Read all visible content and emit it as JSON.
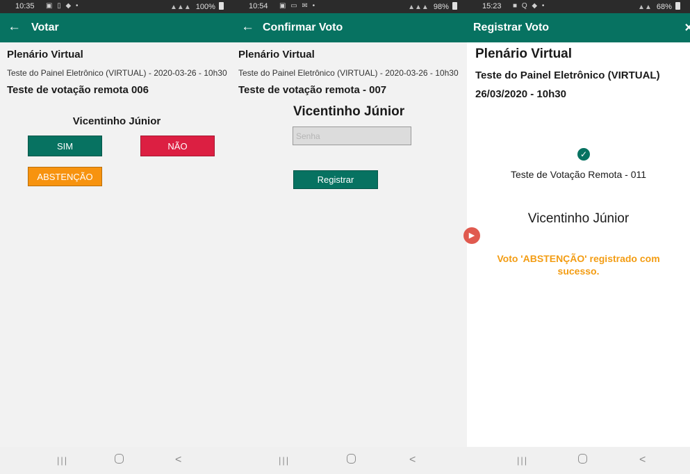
{
  "screen1": {
    "status": {
      "time": "10:35",
      "icons": "▣ ▯ ◆ •",
      "signal": "▲▲▲",
      "battery": "100%"
    },
    "appbar": {
      "back": "←",
      "title": "Votar"
    },
    "org_title": "Plenário Virtual",
    "session": "Teste do Painel Eletrônico (VIRTUAL) - 2020-03-26 - 10h30",
    "vote_title": "Teste de votação remota 006",
    "voter_name": "Vicentinho Júnior",
    "buttons": {
      "sim": "SIM",
      "nao": "NÃO",
      "abstencao": "ABSTENÇÃO"
    },
    "nav": {
      "recents": "|||",
      "back": "<"
    }
  },
  "screen2": {
    "status": {
      "time": "10:54",
      "icons": "▣ ▭ ✉ •",
      "signal": "▲▲▲",
      "battery": "98%"
    },
    "appbar": {
      "back": "←",
      "title": "Confirmar Voto"
    },
    "org_title": "Plenário Virtual",
    "session": "Teste do Painel Eletrônico (VIRTUAL) - 2020-03-26 - 10h30",
    "vote_title": "Teste de votação remota - 007",
    "voter_name": "Vicentinho Júnior",
    "password_placeholder": "Senha",
    "register_label": "Registrar",
    "nav": {
      "recents": "|||",
      "back": "<"
    }
  },
  "screen3": {
    "status": {
      "time": "15:23",
      "icons": "■ Q ◆ •",
      "signal": "▲▲",
      "battery": "68%"
    },
    "appbar": {
      "title": "Registrar Voto",
      "close": "×"
    },
    "org_title": "Plenário Virtual",
    "session": "Teste do Painel Eletrônico (VIRTUAL)",
    "datetime": "26/03/2020 - 10h30",
    "check": "✓",
    "vote_title": "Teste de Votação Remota - 011",
    "voter_name": "Vicentinho Júnior",
    "message": "Voto 'ABSTENÇÃO' registrado com sucesso.",
    "nav": {
      "recents": "|||",
      "back": "<"
    }
  },
  "colors": {
    "primary": "#077261",
    "nao": "#dc1f42",
    "abstencao": "#f7930f",
    "success_text": "#f39c12"
  }
}
